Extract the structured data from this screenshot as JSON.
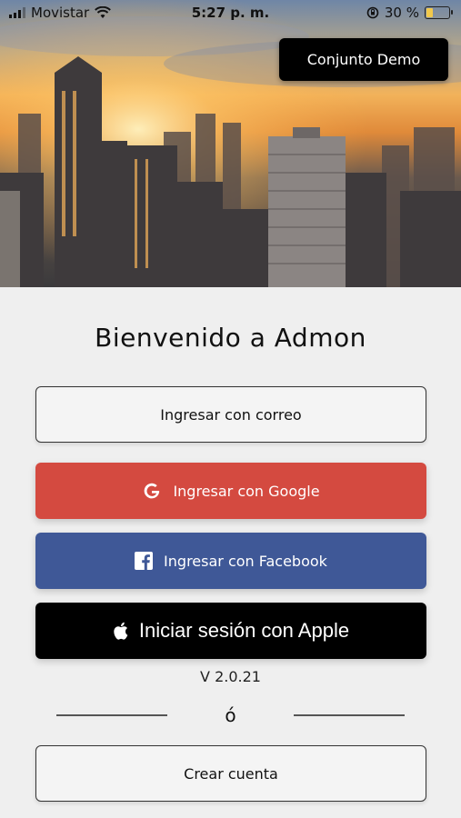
{
  "status_bar": {
    "carrier": "Movistar",
    "time": "5:27 p. m.",
    "battery_percent_label": "30 %",
    "battery_level": 0.3,
    "icons": [
      "signal-icon",
      "wifi-icon",
      "rotation-lock-icon",
      "battery-icon"
    ]
  },
  "hero": {
    "demo_button_label": "Conjunto Demo"
  },
  "main": {
    "title": "Bienvenido a Admon",
    "email_button_label": "Ingresar con correo",
    "google_button_label": "Ingresar con Google",
    "facebook_button_label": "Ingresar con Facebook",
    "apple_button_label": "Iniciar sesión con Apple",
    "version": "V 2.0.21",
    "or_label": "ó",
    "create_account_label": "Crear cuenta"
  },
  "colors": {
    "google": "#d44a40",
    "facebook": "#3f5897",
    "apple": "#000000",
    "background": "#efefef"
  }
}
